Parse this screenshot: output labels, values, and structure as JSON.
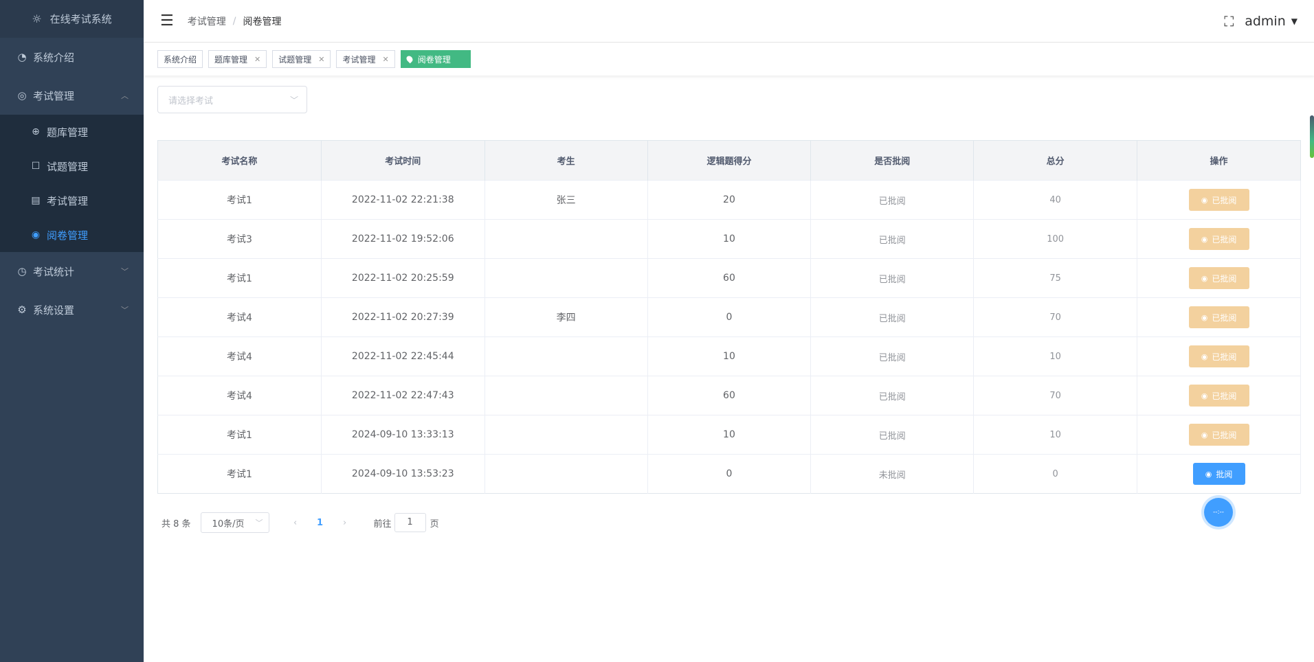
{
  "sidebar": {
    "logo": "在线考试系统",
    "items": [
      {
        "label": "系统介绍",
        "icon": "dashboard-icon"
      },
      {
        "label": "考试管理",
        "icon": "exam-icon",
        "expanded": true
      },
      {
        "label": "考试统计",
        "icon": "chart-icon"
      },
      {
        "label": "系统设置",
        "icon": "settings-icon"
      }
    ],
    "subitems": [
      {
        "label": "题库管理",
        "icon": "target-icon"
      },
      {
        "label": "试题管理",
        "icon": "edit-icon"
      },
      {
        "label": "考试管理",
        "icon": "document-icon"
      },
      {
        "label": "阅卷管理",
        "icon": "eye-icon",
        "active": true
      }
    ]
  },
  "header": {
    "breadcrumb": [
      "考试管理",
      "阅卷管理"
    ],
    "user": "admin"
  },
  "tags": [
    {
      "label": "系统介绍"
    },
    {
      "label": "题库管理"
    },
    {
      "label": "试题管理"
    },
    {
      "label": "考试管理"
    },
    {
      "label": "阅卷管理",
      "active": true
    }
  ],
  "filter": {
    "placeholder": "请选择考试"
  },
  "table": {
    "columns": [
      "考试名称",
      "考试时间",
      "考生",
      "逻辑题得分",
      "是否批阅",
      "总分",
      "操作"
    ],
    "rows": [
      {
        "name": "考试1",
        "time": "2022-11-02 22:21:38",
        "student": "张三",
        "logic": "20",
        "status": "已批阅",
        "total": "40",
        "action": "已批阅"
      },
      {
        "name": "考试3",
        "time": "2022-11-02 19:52:06",
        "student": "",
        "logic": "10",
        "status": "已批阅",
        "total": "100",
        "action": "已批阅"
      },
      {
        "name": "考试1",
        "time": "2022-11-02 20:25:59",
        "student": "",
        "logic": "60",
        "status": "已批阅",
        "total": "75",
        "action": "已批阅"
      },
      {
        "name": "考试4",
        "time": "2022-11-02 20:27:39",
        "student": "李四",
        "logic": "0",
        "status": "已批阅",
        "total": "70",
        "action": "已批阅"
      },
      {
        "name": "考试4",
        "time": "2022-11-02 22:45:44",
        "student": "",
        "logic": "10",
        "status": "已批阅",
        "total": "10",
        "action": "已批阅"
      },
      {
        "name": "考试4",
        "time": "2022-11-02 22:47:43",
        "student": "",
        "logic": "60",
        "status": "已批阅",
        "total": "70",
        "action": "已批阅"
      },
      {
        "name": "考试1",
        "time": "2024-09-10 13:33:13",
        "student": "",
        "logic": "10",
        "status": "已批阅",
        "total": "10",
        "action": "已批阅"
      },
      {
        "name": "考试1",
        "time": "2024-09-10 13:53:23",
        "student": "",
        "logic": "0",
        "status": "未批阅",
        "total": "0",
        "action": "批阅"
      }
    ]
  },
  "pagination": {
    "total": "共 8 条",
    "page_size": "10条/页",
    "current_page": "1",
    "goto_label": "前往",
    "goto_value": "1",
    "page_suffix": "页"
  },
  "float_ball": "--:--",
  "colors": {
    "accent": "#409eff",
    "sidebar": "#304156",
    "tag_active": "#42b983",
    "done_button": "#f3d19e"
  }
}
